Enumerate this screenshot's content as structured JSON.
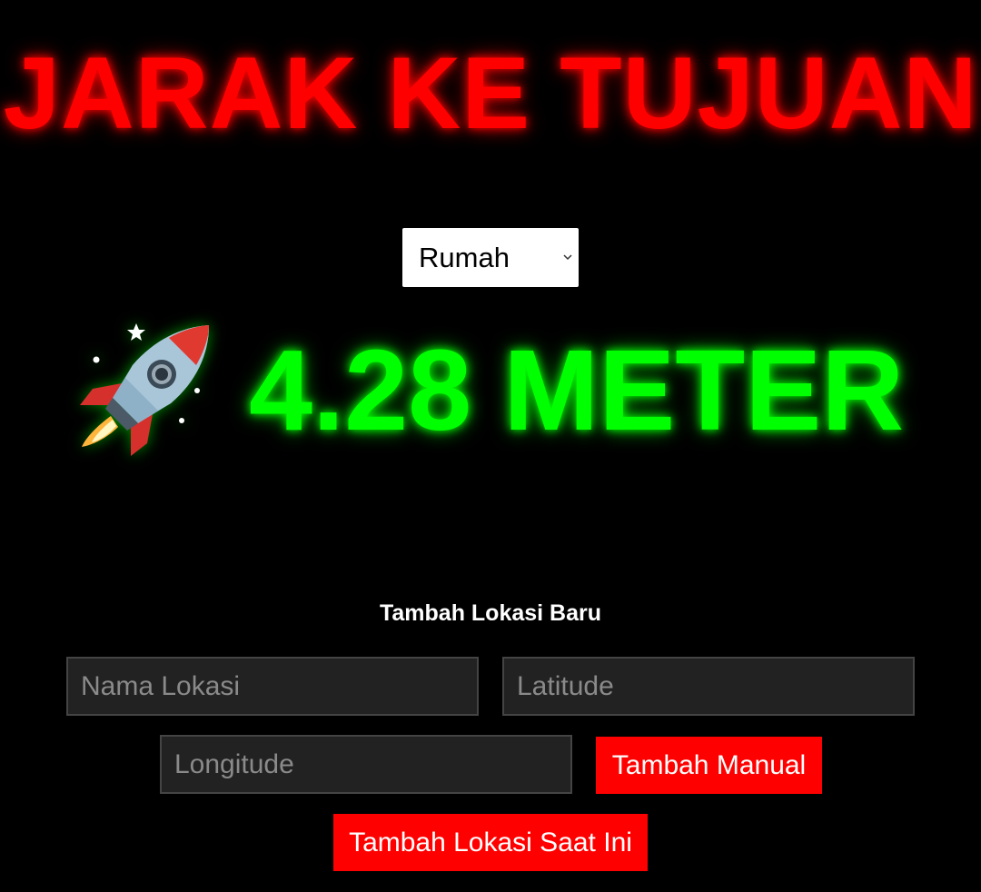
{
  "header": {
    "title": "JARAK KE TUJUAN",
    "title_color": "#ff0000"
  },
  "destination_select": {
    "selected": "Rumah"
  },
  "distance": {
    "icon": "rocket-icon",
    "text": "4.28 METER",
    "color": "#00ff00"
  },
  "add_location": {
    "title": "Tambah Lokasi Baru",
    "name_placeholder": "Nama Lokasi",
    "latitude_placeholder": "Latitude",
    "longitude_placeholder": "Longitude",
    "add_manual_label": "Tambah Manual",
    "add_current_label": "Tambah Lokasi Saat Ini",
    "button_color": "#ff0000"
  }
}
